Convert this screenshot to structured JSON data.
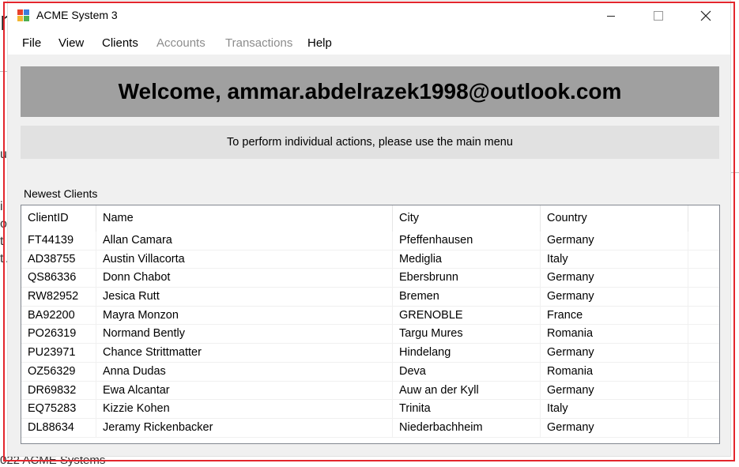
{
  "background": {
    "title_fragment": "n",
    "footer_text": "022 ACME Systems",
    "left_chars": [
      "u",
      "",
      "",
      "i",
      "o:",
      "t",
      "t A"
    ]
  },
  "window": {
    "title": "ACME System 3",
    "icon": "app-icon",
    "controls": {
      "minimize": "minimize-icon",
      "maximize": "maximize-icon",
      "close": "close-icon"
    }
  },
  "menu": {
    "items": [
      {
        "label": "File",
        "enabled": true
      },
      {
        "label": "View",
        "enabled": true
      },
      {
        "label": "Clients",
        "enabled": true
      },
      {
        "label": "Accounts",
        "enabled": false
      },
      {
        "label": "Transactions",
        "enabled": false
      },
      {
        "label": "Help",
        "enabled": true
      }
    ]
  },
  "welcome": {
    "text": "Welcome, ammar.abdelrazek1998@outlook.com"
  },
  "info": {
    "text": "To perform individual actions, please use the main menu"
  },
  "clients": {
    "label": "Newest Clients",
    "columns": [
      "ClientID",
      "Name",
      "City",
      "Country"
    ],
    "rows": [
      [
        "FT44139",
        "Allan Camara",
        "Pfeffenhausen",
        "Germany"
      ],
      [
        "AD38755",
        "Austin Villacorta",
        "Mediglia",
        "Italy"
      ],
      [
        "QS86336",
        "Donn Chabot",
        "Ebersbrunn",
        "Germany"
      ],
      [
        "RW82952",
        "Jesica Rutt",
        "Bremen",
        "Germany"
      ],
      [
        "BA92200",
        "Mayra Monzon",
        "GRENOBLE",
        "France"
      ],
      [
        "PO26319",
        "Normand Bently",
        "Targu Mures",
        "Romania"
      ],
      [
        "PU23971",
        "Chance Strittmatter",
        "Hindelang",
        "Germany"
      ],
      [
        "OZ56329",
        "Anna Dudas",
        "Deva",
        "Romania"
      ],
      [
        "DR69832",
        "Ewa Alcantar",
        "Auw an der Kyll",
        "Germany"
      ],
      [
        "EQ75283",
        "Kizzie Kohen",
        "Trinita",
        "Italy"
      ],
      [
        "DL88634",
        "Jeramy Rickenbacker",
        "Niederbachheim",
        "Germany"
      ]
    ]
  },
  "colors": {
    "frame": "#e3262d",
    "welcome_bg": "#a0a0a0",
    "info_bg": "#e1e1e1",
    "disabled_text": "#8c8c8c"
  }
}
